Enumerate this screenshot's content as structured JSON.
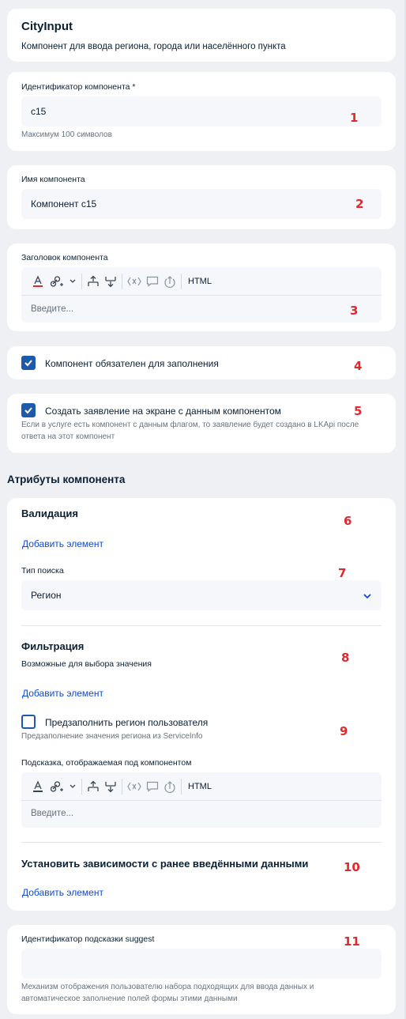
{
  "header": {
    "title": "CityInput",
    "description": "Компонент для ввода региона, города или населённого пункта"
  },
  "id_field": {
    "label": "Идентификатор компонента *",
    "value": "c15",
    "hint": "Максимум 100 символов",
    "marker": "1"
  },
  "name_field": {
    "label": "Имя компонента",
    "value": "Компонент c15",
    "marker": "2"
  },
  "heading_field": {
    "label": "Заголовок компонента",
    "placeholder": "Введите...",
    "html_label": "HTML",
    "marker": "3"
  },
  "required_check": {
    "label": "Компонент обязателен для заполнения",
    "checked": true,
    "marker": "4"
  },
  "statement_check": {
    "label": "Создать заявление на экране с данным компонентом",
    "hint_line1": "Если в услуге есть компонент с данным флагом, то заявление будет создано в LKApi после",
    "hint_line2": "ответа на этот компонент",
    "checked": true,
    "marker": "5"
  },
  "attributes": {
    "section_title": "Атрибуты компонента",
    "validation": {
      "title": "Валидация",
      "add_link": "Добавить элемент",
      "marker": "6"
    },
    "search_type": {
      "label": "Тип поиска",
      "value": "Регион",
      "marker": "7"
    },
    "filtration": {
      "title": "Фильтрация",
      "subtitle": "Возможные для выбора значения",
      "add_link": "Добавить элемент",
      "marker": "8"
    },
    "prefill": {
      "label": "Предзаполнить регион пользователя",
      "hint": "Предзаполнение значения региона из ServiceInfo",
      "checked": false,
      "marker": "9"
    },
    "hint_editor": {
      "label": "Подсказка, отображаемая под компонентом",
      "placeholder": "Введите...",
      "html_label": "HTML"
    },
    "dependencies": {
      "title": "Установить зависимости с ранее введёнными данными",
      "add_link": "Добавить элемент",
      "marker": "10"
    }
  },
  "suggest_field": {
    "label": "Идентификатор подсказки suggest",
    "value": "",
    "hint_line1": "Механизм отображения пользователю набора подходящих для ввода данных и",
    "hint_line2": "автоматическое заполнение полей формы этими данными",
    "marker": "11"
  },
  "colors": {
    "background": "#eef0f4",
    "card": "#ffffff",
    "link": "#0d4cd3",
    "checkbox": "#1d5aab",
    "marker": "#e0282e"
  }
}
